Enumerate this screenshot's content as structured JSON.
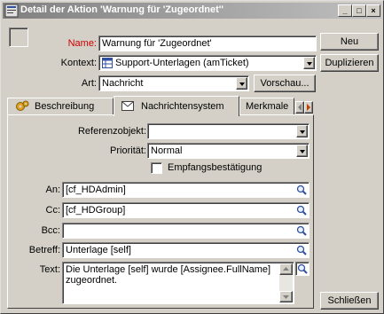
{
  "window": {
    "title": "Detail der Aktion 'Warnung für 'Zugeordnet''",
    "buttons": [
      "_",
      "□",
      "×"
    ]
  },
  "form": {
    "name_label": "Name:",
    "name_value": "Warnung für 'Zugeordnet'",
    "context_label": "Kontext:",
    "context_value": "Support-Unterlagen (amTicket)",
    "type_label": "Art:",
    "type_value": "Nachricht",
    "preview_button": "Vorschau..."
  },
  "side_buttons": {
    "new": "Neu",
    "duplicate": "Duplizieren",
    "close": "Schließen"
  },
  "tabs": [
    {
      "label": "Beschreibung",
      "icon": "gears-icon"
    },
    {
      "label": "Nachrichtensystem",
      "icon": "envelope-icon"
    },
    {
      "label": "Merkmale",
      "icon": ""
    }
  ],
  "messaging": {
    "ref_object_label": "Referenzobjekt:",
    "ref_object_value": "",
    "priority_label": "Priorität:",
    "priority_value": "Normal",
    "receipt_label": "Empfangsbestätigung",
    "receipt_checked": false,
    "to_label": "An:",
    "to_value": "[cf_HDAdmin]",
    "cc_label": "Cc:",
    "cc_value": "[cf_HDGroup]",
    "bcc_label": "Bcc:",
    "bcc_value": "",
    "subject_label": "Betreff:",
    "subject_value": "Unterlage [self]",
    "text_label": "Text:",
    "text_line1": "Die Unterlage [self] wurde [Assignee.FullName]",
    "text_line2": "zugeordnet."
  },
  "colors": {
    "title_gradient_start": "#808080",
    "title_gradient_end": "#c0c0c0",
    "face": "#d4d0c8",
    "name_label": "#cc0000"
  }
}
